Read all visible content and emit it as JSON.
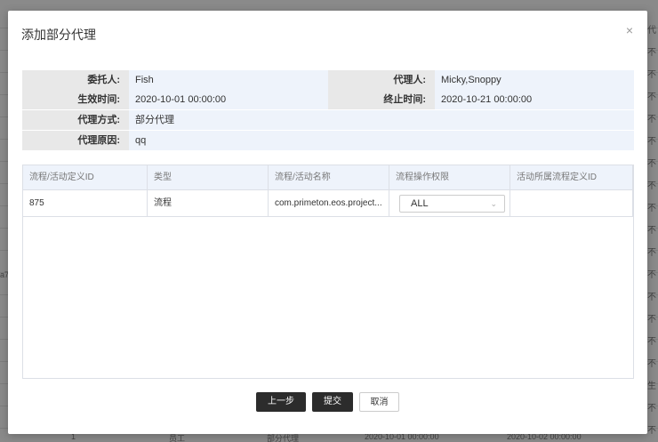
{
  "background": {
    "right_column_texts": [
      "代",
      "不",
      "不",
      "不",
      "不",
      "不",
      "不",
      "不",
      "不",
      "不",
      "不",
      "不",
      "不",
      "不",
      "不",
      "不",
      "生",
      "不",
      "不"
    ],
    "left_fragment": "a7",
    "bottom_row": [
      "1",
      "员工",
      "部分代理",
      "2020-10-01 00:00:00",
      "2020-10-02 00:00:00"
    ]
  },
  "modal": {
    "title": "添加部分代理",
    "close_icon": "×"
  },
  "info": {
    "principal_label": "委托人:",
    "principal_value": "Fish",
    "agent_label": "代理人:",
    "agent_value": "Micky,Snoppy",
    "start_label": "生效时间:",
    "start_value": "2020-10-01 00:00:00",
    "end_label": "终止时间:",
    "end_value": "2020-10-21 00:00:00",
    "mode_label": "代理方式:",
    "mode_value": "部分代理",
    "reason_label": "代理原因:",
    "reason_value": "qq"
  },
  "table": {
    "columns": [
      "流程/活动定义ID",
      "类型",
      "流程/活动名称",
      "流程操作权限",
      "活动所属流程定义ID"
    ],
    "rows": [
      {
        "id": "875",
        "type": "流程",
        "name": "com.primeton.eos.project...",
        "permission": "ALL",
        "parent_id": ""
      }
    ]
  },
  "buttons": {
    "prev": "上一步",
    "submit": "提交",
    "cancel": "取消"
  }
}
